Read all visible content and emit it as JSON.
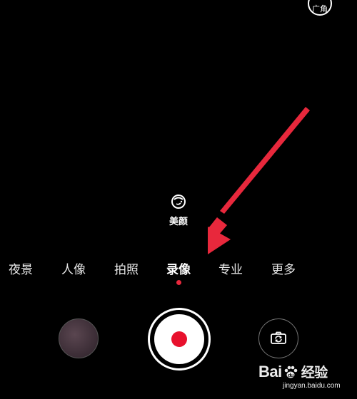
{
  "top_button": {
    "label": "广角",
    "icon": "wide-angle-icon"
  },
  "beauty": {
    "label": "美颜",
    "icon": "beauty-face-icon"
  },
  "modes": [
    {
      "label": "夜景"
    },
    {
      "label": "人像"
    },
    {
      "label": "拍照"
    },
    {
      "label": "录像",
      "active": true
    },
    {
      "label": "专业"
    },
    {
      "label": "更多"
    }
  ],
  "controls": {
    "gallery": "gallery-thumbnail",
    "shutter": "record-button",
    "switch": "switch-camera-icon"
  },
  "colors": {
    "background": "#000000",
    "record_red": "#e8112d",
    "active_dot": "#e8283c",
    "annotation_arrow": "#e8283c"
  },
  "watermark": {
    "brand_left": "Bai",
    "brand_right": "经验",
    "url": "jingyan.baidu.com"
  }
}
